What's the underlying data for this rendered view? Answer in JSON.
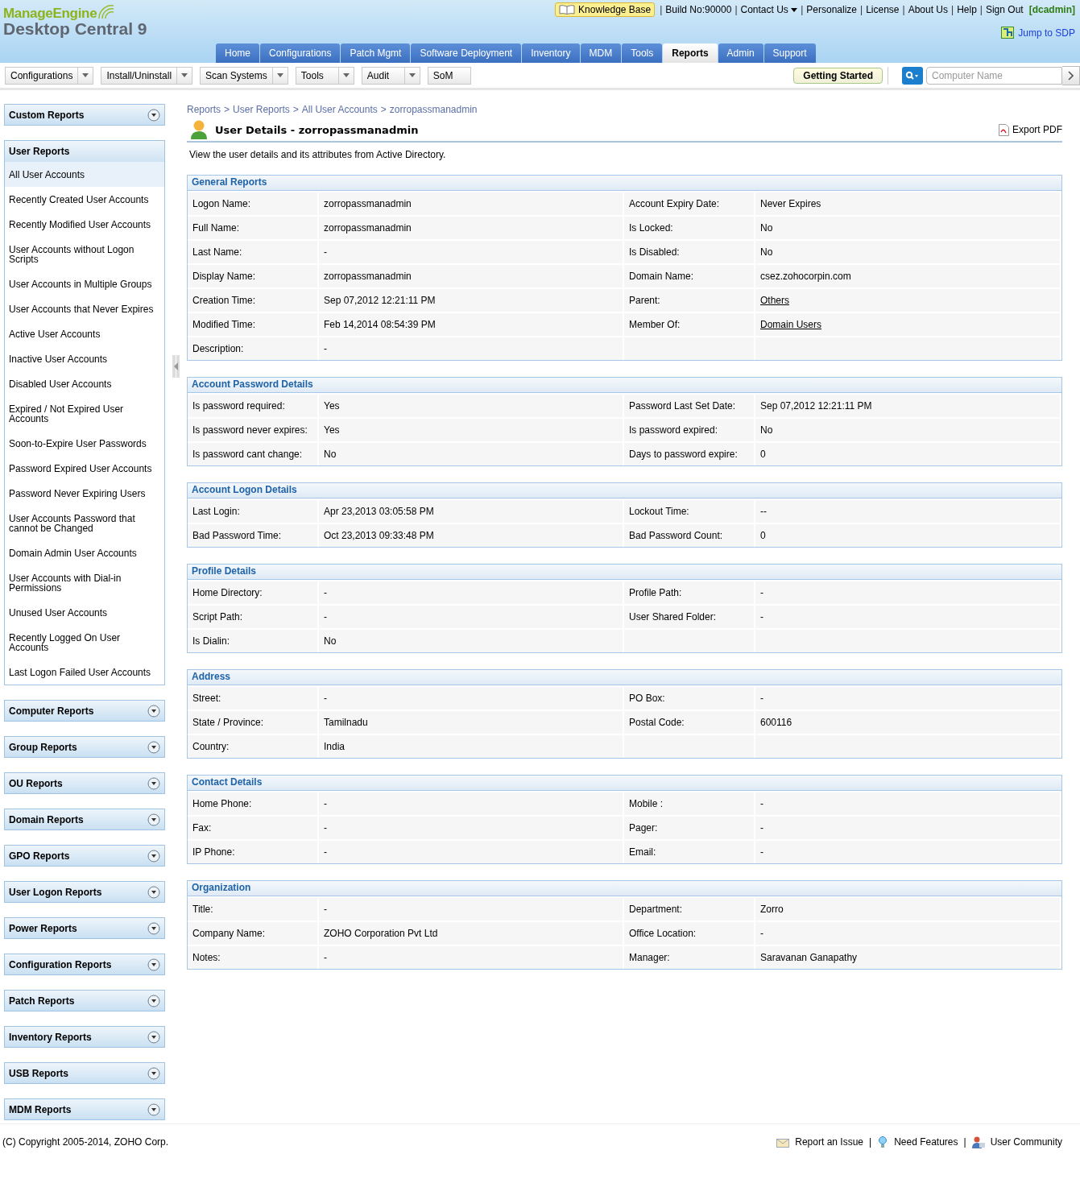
{
  "logo": {
    "brand": "ManageEngine",
    "product": "Desktop Central 9"
  },
  "top_bar": [
    {
      "kind": "kb",
      "text": "Knowledge Base"
    },
    {
      "kind": "sep",
      "text": "|"
    },
    {
      "kind": "text",
      "text": "Build No:90000"
    },
    {
      "kind": "sep",
      "text": "|"
    },
    {
      "kind": "menu",
      "text": "Contact Us"
    },
    {
      "kind": "sep",
      "text": "|"
    },
    {
      "kind": "link",
      "text": "Personalize"
    },
    {
      "kind": "sep",
      "text": "|"
    },
    {
      "kind": "link",
      "text": "License"
    },
    {
      "kind": "sep",
      "text": "|"
    },
    {
      "kind": "link",
      "text": "About Us"
    },
    {
      "kind": "sep",
      "text": "|"
    },
    {
      "kind": "link",
      "text": "Help"
    },
    {
      "kind": "sep",
      "text": "|"
    },
    {
      "kind": "link",
      "text": "Sign Out"
    },
    {
      "kind": "user",
      "text": "[dcadmin]"
    }
  ],
  "jump_link": "Jump to SDP",
  "nav_tabs": [
    {
      "label": "Home",
      "selected": false
    },
    {
      "label": "Configurations",
      "selected": false
    },
    {
      "label": "Patch Mgmt",
      "selected": false
    },
    {
      "label": "Software Deployment",
      "selected": false
    },
    {
      "label": "Inventory",
      "selected": false
    },
    {
      "label": "MDM",
      "selected": false
    },
    {
      "label": "Tools",
      "selected": false
    },
    {
      "label": "Reports",
      "selected": true
    },
    {
      "label": "Admin",
      "selected": false
    },
    {
      "label": "Support",
      "selected": false
    }
  ],
  "toolbar": [
    {
      "label": "Configurations",
      "has_menu": true
    },
    {
      "label": "Install/Uninstall",
      "has_menu": true
    },
    {
      "label": "Scan Systems",
      "has_menu": true
    },
    {
      "label": "Tools",
      "has_menu": true
    },
    {
      "label": "Audit",
      "has_menu": true
    },
    {
      "label": "SoM",
      "has_menu": false
    }
  ],
  "getting_started": "Getting Started",
  "search": {
    "placeholder": "Computer Name"
  },
  "sidebar": [
    {
      "title": "Custom Reports",
      "expanded": false
    },
    {
      "title": "User Reports",
      "expanded": true,
      "items": [
        {
          "label": "All User Accounts",
          "selected": true
        },
        {
          "label": "Recently Created User Accounts",
          "selected": false
        },
        {
          "label": "Recently Modified User Accounts",
          "selected": false
        },
        {
          "label": "User Accounts without Logon Scripts",
          "selected": false
        },
        {
          "label": "User Accounts in Multiple Groups",
          "selected": false
        },
        {
          "label": "User Accounts that Never Expires",
          "selected": false
        },
        {
          "label": "Active User Accounts",
          "selected": false
        },
        {
          "label": "Inactive User Accounts",
          "selected": false
        },
        {
          "label": "Disabled User Accounts",
          "selected": false
        },
        {
          "label": "Expired / Not Expired User Accounts",
          "selected": false
        },
        {
          "label": "Soon-to-Expire User Passwords",
          "selected": false
        },
        {
          "label": "Password Expired User Accounts",
          "selected": false
        },
        {
          "label": "Password Never Expiring Users",
          "selected": false
        },
        {
          "label": "User Accounts Password that cannot be Changed",
          "selected": false
        },
        {
          "label": "Domain Admin User Accounts",
          "selected": false
        },
        {
          "label": "User Accounts with Dial-in Permissions",
          "selected": false
        },
        {
          "label": "Unused User Accounts",
          "selected": false
        },
        {
          "label": "Recently Logged On User Accounts",
          "selected": false
        },
        {
          "label": "Last Logon Failed User Accounts",
          "selected": false
        }
      ]
    },
    {
      "title": "Computer Reports",
      "expanded": false
    },
    {
      "title": "Group Reports",
      "expanded": false
    },
    {
      "title": "OU Reports",
      "expanded": false
    },
    {
      "title": "Domain Reports",
      "expanded": false
    },
    {
      "title": "GPO Reports",
      "expanded": false
    },
    {
      "title": "User Logon Reports",
      "expanded": false
    },
    {
      "title": "Power Reports",
      "expanded": false
    },
    {
      "title": "Configuration Reports",
      "expanded": false
    },
    {
      "title": "Patch Reports",
      "expanded": false
    },
    {
      "title": "Inventory Reports",
      "expanded": false
    },
    {
      "title": "USB Reports",
      "expanded": false
    },
    {
      "title": "MDM Reports",
      "expanded": false
    }
  ],
  "breadcrumb": [
    "Reports",
    "User Reports",
    "All User Accounts",
    "zorropassmanadmin"
  ],
  "breadcrumb_separator": ">",
  "page_title": "User Details - zorropassmanadmin",
  "export_pdf": "Export PDF",
  "description": "View the user details and its attributes from Active Directory.",
  "sections": [
    {
      "title": "General Reports",
      "rows": [
        [
          {
            "kind": "label",
            "text": "Logon Name:"
          },
          {
            "kind": "value",
            "text": "zorropassmanadmin"
          },
          {
            "kind": "label",
            "text": "Account Expiry Date:"
          },
          {
            "kind": "value",
            "text": "Never Expires"
          }
        ],
        [
          {
            "kind": "label",
            "text": "Full Name:"
          },
          {
            "kind": "value",
            "text": "zorropassmanadmin"
          },
          {
            "kind": "label",
            "text": "Is Locked:"
          },
          {
            "kind": "value",
            "text": "No"
          }
        ],
        [
          {
            "kind": "label",
            "text": "Last Name:"
          },
          {
            "kind": "value",
            "text": "-"
          },
          {
            "kind": "label",
            "text": "Is Disabled:"
          },
          {
            "kind": "value",
            "text": "No"
          }
        ],
        [
          {
            "kind": "label",
            "text": "Display Name:"
          },
          {
            "kind": "value",
            "text": "zorropassmanadmin"
          },
          {
            "kind": "label",
            "text": "Domain Name:"
          },
          {
            "kind": "value",
            "text": "csez.zohocorpin.com"
          }
        ],
        [
          {
            "kind": "label",
            "text": "Creation Time:"
          },
          {
            "kind": "value",
            "text": "Sep 07,2012 12:21:11 PM"
          },
          {
            "kind": "label",
            "text": "Parent:"
          },
          {
            "kind": "link",
            "text": "Others"
          }
        ],
        [
          {
            "kind": "label",
            "text": "Modified Time:"
          },
          {
            "kind": "value",
            "text": "Feb 14,2014 08:54:39 PM"
          },
          {
            "kind": "label",
            "text": "Member Of:"
          },
          {
            "kind": "link",
            "text": "Domain Users"
          }
        ],
        [
          {
            "kind": "label",
            "text": "Description:"
          },
          {
            "kind": "value",
            "text": "-"
          }
        ]
      ]
    },
    {
      "title": "Account Password Details",
      "rows": [
        [
          {
            "kind": "label",
            "text": "Is password required:"
          },
          {
            "kind": "value",
            "text": "Yes"
          },
          {
            "kind": "label",
            "text": "Password Last Set Date:"
          },
          {
            "kind": "value",
            "text": "Sep 07,2012 12:21:11 PM"
          }
        ],
        [
          {
            "kind": "label",
            "text": "Is password never expires:"
          },
          {
            "kind": "value",
            "text": "Yes"
          },
          {
            "kind": "label",
            "text": "Is password expired:"
          },
          {
            "kind": "value",
            "text": "No"
          }
        ],
        [
          {
            "kind": "label",
            "text": "Is password cant change:"
          },
          {
            "kind": "value",
            "text": "No"
          },
          {
            "kind": "label",
            "text": "Days to password expire:"
          },
          {
            "kind": "value",
            "text": "0"
          }
        ]
      ]
    },
    {
      "title": "Account Logon Details",
      "rows": [
        [
          {
            "kind": "label",
            "text": "Last Login:"
          },
          {
            "kind": "value",
            "text": "Apr 23,2013 03:05:58 PM"
          },
          {
            "kind": "label",
            "text": "Lockout Time:"
          },
          {
            "kind": "value",
            "text": "--"
          }
        ],
        [
          {
            "kind": "label",
            "text": "Bad Password Time:"
          },
          {
            "kind": "value",
            "text": "Oct 23,2013 09:33:48 PM"
          },
          {
            "kind": "label",
            "text": "Bad Password Count:"
          },
          {
            "kind": "value",
            "text": "0"
          }
        ]
      ]
    },
    {
      "title": "Profile Details",
      "rows": [
        [
          {
            "kind": "label",
            "text": "Home Directory:"
          },
          {
            "kind": "value",
            "text": "-"
          },
          {
            "kind": "label",
            "text": "Profile Path:"
          },
          {
            "kind": "value",
            "text": "-"
          }
        ],
        [
          {
            "kind": "label",
            "text": "Script Path:"
          },
          {
            "kind": "value",
            "text": "-"
          },
          {
            "kind": "label",
            "text": "User Shared Folder:"
          },
          {
            "kind": "value",
            "text": "-"
          }
        ],
        [
          {
            "kind": "label",
            "text": "Is Dialin:"
          },
          {
            "kind": "value",
            "text": "No"
          }
        ]
      ]
    },
    {
      "title": "Address",
      "rows": [
        [
          {
            "kind": "label",
            "text": "Street:"
          },
          {
            "kind": "value",
            "text": "-"
          },
          {
            "kind": "label",
            "text": "PO Box:"
          },
          {
            "kind": "value",
            "text": "-"
          }
        ],
        [
          {
            "kind": "label",
            "text": "State / Province:"
          },
          {
            "kind": "value",
            "text": "Tamilnadu"
          },
          {
            "kind": "label",
            "text": "Postal Code:"
          },
          {
            "kind": "value",
            "text": "600116"
          }
        ],
        [
          {
            "kind": "label",
            "text": "Country:"
          },
          {
            "kind": "value",
            "text": "India"
          }
        ]
      ]
    },
    {
      "title": "Contact Details",
      "rows": [
        [
          {
            "kind": "label",
            "text": "Home Phone:"
          },
          {
            "kind": "value",
            "text": "-"
          },
          {
            "kind": "label",
            "text": "Mobile :"
          },
          {
            "kind": "value",
            "text": "-"
          }
        ],
        [
          {
            "kind": "label",
            "text": "Fax:"
          },
          {
            "kind": "value",
            "text": "-"
          },
          {
            "kind": "label",
            "text": "Pager:"
          },
          {
            "kind": "value",
            "text": "-"
          }
        ],
        [
          {
            "kind": "label",
            "text": "IP Phone:"
          },
          {
            "kind": "value",
            "text": "-"
          },
          {
            "kind": "label",
            "text": "Email:"
          },
          {
            "kind": "value",
            "text": "-"
          }
        ]
      ]
    },
    {
      "title": "Organization",
      "rows": [
        [
          {
            "kind": "label",
            "text": "Title:"
          },
          {
            "kind": "value",
            "text": "-"
          },
          {
            "kind": "label",
            "text": "Department:"
          },
          {
            "kind": "value",
            "text": "Zorro"
          }
        ],
        [
          {
            "kind": "label",
            "text": "Company Name:"
          },
          {
            "kind": "value",
            "text": "ZOHO Corporation Pvt Ltd"
          },
          {
            "kind": "label",
            "text": "Office Location:"
          },
          {
            "kind": "value",
            "text": "-"
          }
        ],
        [
          {
            "kind": "label",
            "text": "Notes:"
          },
          {
            "kind": "value",
            "text": "-"
          },
          {
            "kind": "label",
            "text": "Manager:"
          },
          {
            "kind": "value",
            "text": "Saravanan Ganapathy"
          }
        ]
      ]
    }
  ],
  "footer": {
    "copyright": "(C) Copyright 2005-2014, ZOHO Corp.",
    "links": [
      {
        "kind": "report",
        "text": "Report an Issue"
      },
      {
        "kind": "sep",
        "text": "|"
      },
      {
        "kind": "features",
        "text": "Need Features"
      },
      {
        "kind": "sep",
        "text": "|"
      },
      {
        "kind": "community",
        "text": "User Community"
      }
    ]
  }
}
